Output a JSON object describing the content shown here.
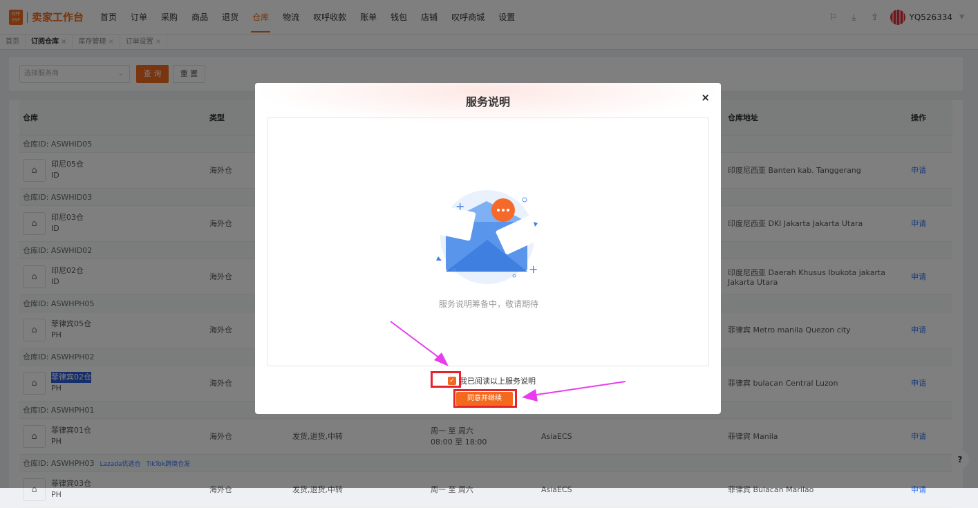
{
  "logo": {
    "badge": "叹呼\nERP",
    "title": "卖家工作台"
  },
  "nav": [
    "首页",
    "订单",
    "采购",
    "商品",
    "退货",
    "仓库",
    "物流",
    "叹呼收款",
    "账单",
    "钱包",
    "店铺",
    "叹呼商城",
    "设置"
  ],
  "nav_active": 5,
  "user": {
    "name": "YQ526334"
  },
  "tabs": [
    {
      "label": "首页"
    },
    {
      "label": "订阅仓库"
    },
    {
      "label": "库存管理"
    },
    {
      "label": "订单设置"
    }
  ],
  "filter": {
    "placeholder": "选择服务商",
    "query": "查 询",
    "reset": "重 置"
  },
  "table": {
    "headers": {
      "warehouse": "仓库",
      "type": "类型",
      "address": "仓库地址",
      "action": "操作"
    },
    "groups": [
      {
        "id": "仓库ID: ASWHID05",
        "name": "印尼05仓",
        "code": "ID",
        "type": "海外仓",
        "service": "",
        "hours1": "",
        "hours2": "",
        "provider": "",
        "address": "印度尼西亚 Banten kab. Tanggerang",
        "action": "申请"
      },
      {
        "id": "仓库ID: ASWHID03",
        "name": "印尼03仓",
        "code": "ID",
        "type": "海外仓",
        "service": "",
        "hours1": "",
        "hours2": "",
        "provider": "",
        "address": "印度尼西亚 DKI Jakarta Jakarta Utara",
        "action": "申请"
      },
      {
        "id": "仓库ID: ASWHID02",
        "name": "印尼02仓",
        "code": "ID",
        "type": "海外仓",
        "service": "",
        "hours1": "",
        "hours2": "",
        "provider": "",
        "address": "印度尼西亚 Daerah Khusus Ibukota jakarta Jakarta Utara",
        "action": "申请"
      },
      {
        "id": "仓库ID: ASWHPH05",
        "name": "菲律宾05仓",
        "code": "PH",
        "type": "海外仓",
        "service": "",
        "hours1": "",
        "hours2": "",
        "provider": "",
        "address": "菲律宾 Metro manila Quezon city",
        "action": "申请"
      },
      {
        "id": "仓库ID: ASWHPH02",
        "name": "菲律宾02仓",
        "code": "PH",
        "type": "海外仓",
        "service": "",
        "hours1": "",
        "hours2": "",
        "provider": "",
        "address": "菲律宾 bulacan Central Luzon",
        "action": "申请"
      },
      {
        "id": "仓库ID: ASWHPH01",
        "name": "菲律宾01仓",
        "code": "PH",
        "type": "海外仓",
        "service": "发货,退货,中转",
        "hours1": "周一 至 周六",
        "hours2": "08:00 至 18:00",
        "provider": "AsiaECS",
        "address": "菲律宾 Manila",
        "action": "申请"
      },
      {
        "id": "仓库ID: ASWHPH03",
        "name": "菲律宾03仓",
        "code": "PH",
        "type": "海外仓",
        "service": "发货,退货,中转",
        "hours1": "周一 至 周六",
        "hours2": "",
        "provider": "AsiaECS",
        "address": "菲律宾 Bulacan Marilao",
        "action": "申请",
        "tags": [
          "Lazada优选仓",
          "TikTok跨境仓发"
        ]
      }
    ]
  },
  "modal": {
    "title": "服务说明",
    "close": "×",
    "empty": "服务说明筹备中，敬请期待",
    "agree": "我已阅读以上服务说明",
    "continue": "同意并继续"
  },
  "help": "?",
  "colors": {
    "accent": "#f36a1d",
    "link": "#3478f6",
    "annotation": "#e8222c",
    "arrow": "#e83cf0"
  }
}
